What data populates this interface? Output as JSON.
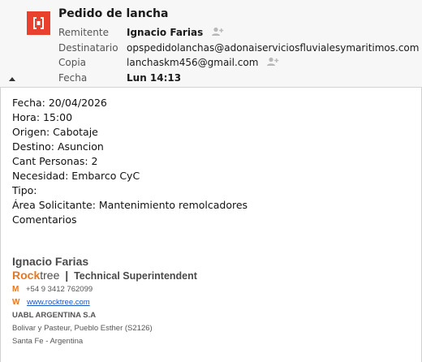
{
  "message": {
    "subject": "Pedido de lancha",
    "fields": [
      {
        "label": "Remitente",
        "value": "Ignacio Farias",
        "bold": true,
        "person_icon": true
      },
      {
        "label": "Destinatario",
        "value": "opspedidolanchas@adonaiserviciosfluvialesymaritimos.com",
        "bold": false,
        "person_icon": true
      },
      {
        "label": "Copia",
        "value": "lanchaskm456@gmail.com",
        "bold": false,
        "person_icon": true
      },
      {
        "label": "Fecha",
        "value": "Lun 14:13",
        "bold": true,
        "person_icon": false
      }
    ]
  },
  "body": {
    "lines": [
      "Fecha: 20/04/2026",
      "Hora: 15:00",
      "Origen: Cabotaje",
      "Destino: Asuncion",
      "Cant Personas: 2",
      "Necesidad: Embarco CyC",
      "Tipo:",
      "Área Solicitante: Mantenimiento remolcadores",
      "Comentarios"
    ]
  },
  "signature": {
    "name": "Ignacio Farias",
    "brand_part1": "Rock",
    "brand_part2": "tree",
    "separator": "|",
    "role": "Technical Superintendent",
    "mobile_letter": "M",
    "mobile": "+54 9 3412 762099",
    "web_letter": "W",
    "web": "www.rocktree.com",
    "org": "UABL ARGENTINA S.A",
    "address1": "Bolivar y Pasteur, Pueblo Esther (S2126)",
    "address2": "Santa Fe - Argentina"
  },
  "icons": {
    "app": "message-app-icon",
    "person": "add-person-icon",
    "collapse": "collapse-header-icon"
  },
  "colors": {
    "app_icon": "#e8412d",
    "brand_orange": "#e87722",
    "link": "#1a56c4"
  }
}
